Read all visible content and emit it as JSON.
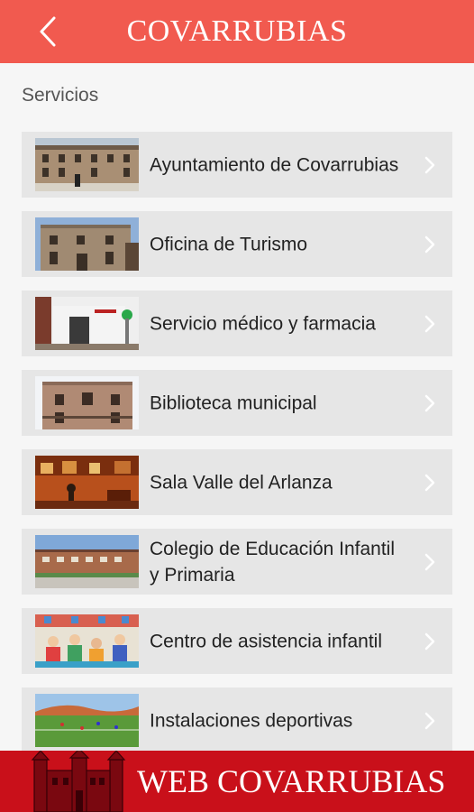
{
  "header": {
    "title": "COVARRUBIAS",
    "back_icon": "chevron-left-icon",
    "color": "#f15a4f"
  },
  "section": {
    "label": "Servicios"
  },
  "items": [
    {
      "label": "Ayuntamiento de Covarrubias",
      "icon": "chevron-right-icon"
    },
    {
      "label": "Oficina de Turismo",
      "icon": "chevron-right-icon"
    },
    {
      "label": "Servicio médico y farmacia",
      "icon": "chevron-right-icon"
    },
    {
      "label": "Biblioteca municipal",
      "icon": "chevron-right-icon"
    },
    {
      "label": "Sala Valle del Arlanza",
      "icon": "chevron-right-icon"
    },
    {
      "label": "Colegio de Educación Infantil y Primaria",
      "icon": "chevron-right-icon"
    },
    {
      "label": "Centro de asistencia infantil",
      "icon": "chevron-right-icon"
    },
    {
      "label": "Instalaciones deportivas",
      "icon": "chevron-right-icon"
    }
  ],
  "footer": {
    "title": "WEB COVARRUBIAS",
    "color": "#c9101a"
  }
}
